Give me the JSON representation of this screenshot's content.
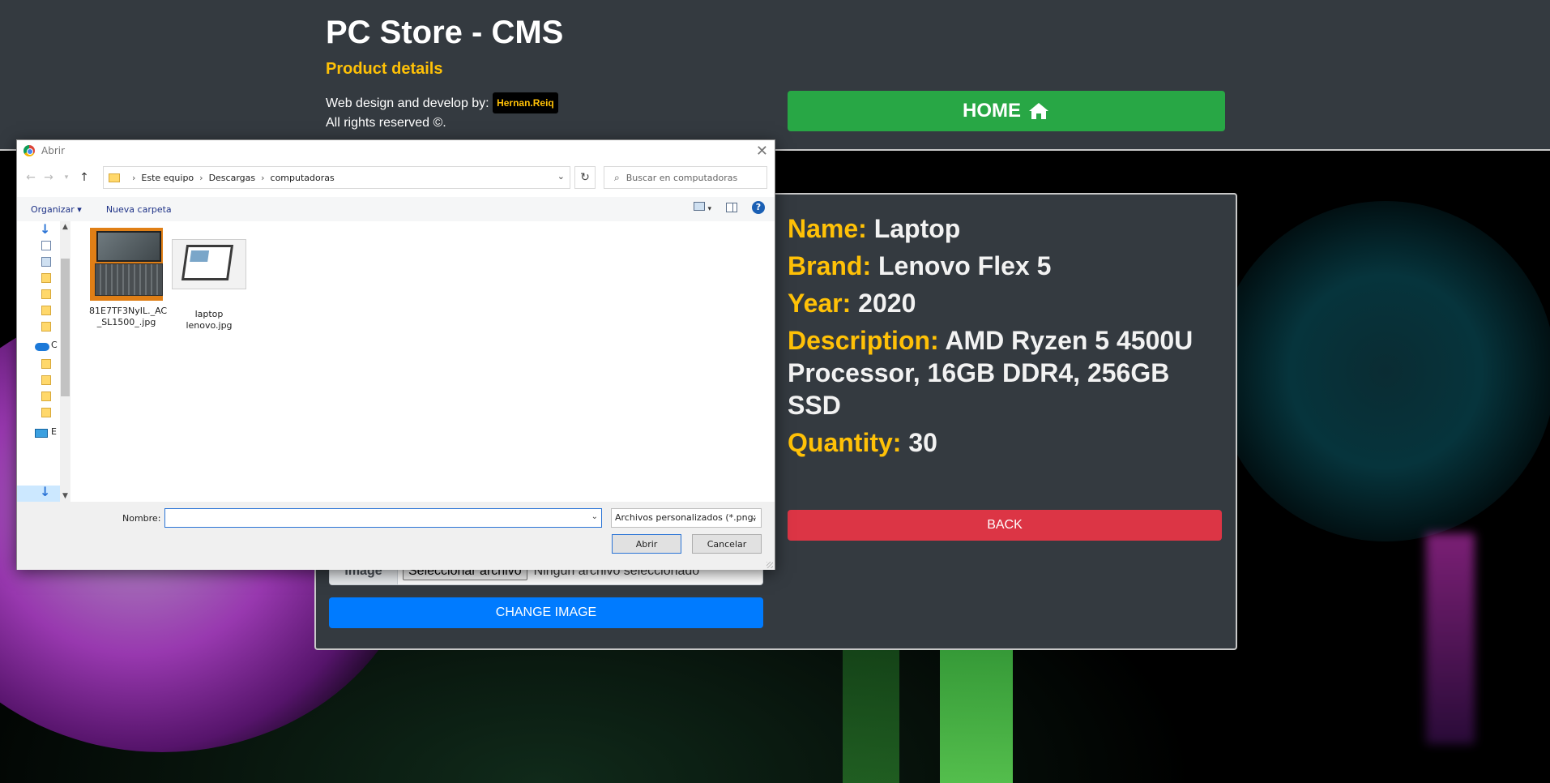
{
  "header": {
    "title": "PC Store - CMS",
    "subtitle": "Product details",
    "credits_prefix": "Web design and develop by:",
    "author": "Hernan.Reiq",
    "rights": "All rights reserved ©.",
    "home_label": "HOME"
  },
  "product": {
    "name_key": "Name:",
    "name_value": "Laptop",
    "brand_key": "Brand:",
    "brand_value": "Lenovo Flex 5",
    "year_key": "Year:",
    "year_value": "2020",
    "description_key": "Description:",
    "description_value": "AMD Ryzen 5 4500U Processor, 16GB DDR4, 256GB SSD",
    "quantity_key": "Quantity:",
    "quantity_value": "30",
    "back_label": "BACK"
  },
  "upload": {
    "label": "Image",
    "choose_label": "Seleccionar archivo",
    "status": "Ningún archivo seleccionado",
    "submit_label": "CHANGE IMAGE"
  },
  "dialog": {
    "title": "Abrir",
    "breadcrumb": [
      "Este equipo",
      "Descargas",
      "computadoras"
    ],
    "search_placeholder": "Buscar en computadoras",
    "organize_label": "Organizar",
    "new_folder_label": "Nueva carpeta",
    "files": [
      {
        "name_line1": "81E7TF3NyIL._AC",
        "name_line2": "_SL1500_.jpg"
      },
      {
        "name_line1": "laptop",
        "name_line2": "lenovo.jpg"
      }
    ],
    "sidebar_letters": [
      "C",
      "E"
    ],
    "filename_label": "Nombre:",
    "filename_value": "",
    "filter_value": "Archivos personalizados (*.png;",
    "open_label": "Abrir",
    "cancel_label": "Cancelar"
  },
  "colors": {
    "accent_yellow": "#ffc107",
    "header_bg": "#343a40",
    "home_green": "#28a745",
    "back_red": "#dc3545",
    "change_blue": "#007bff"
  }
}
